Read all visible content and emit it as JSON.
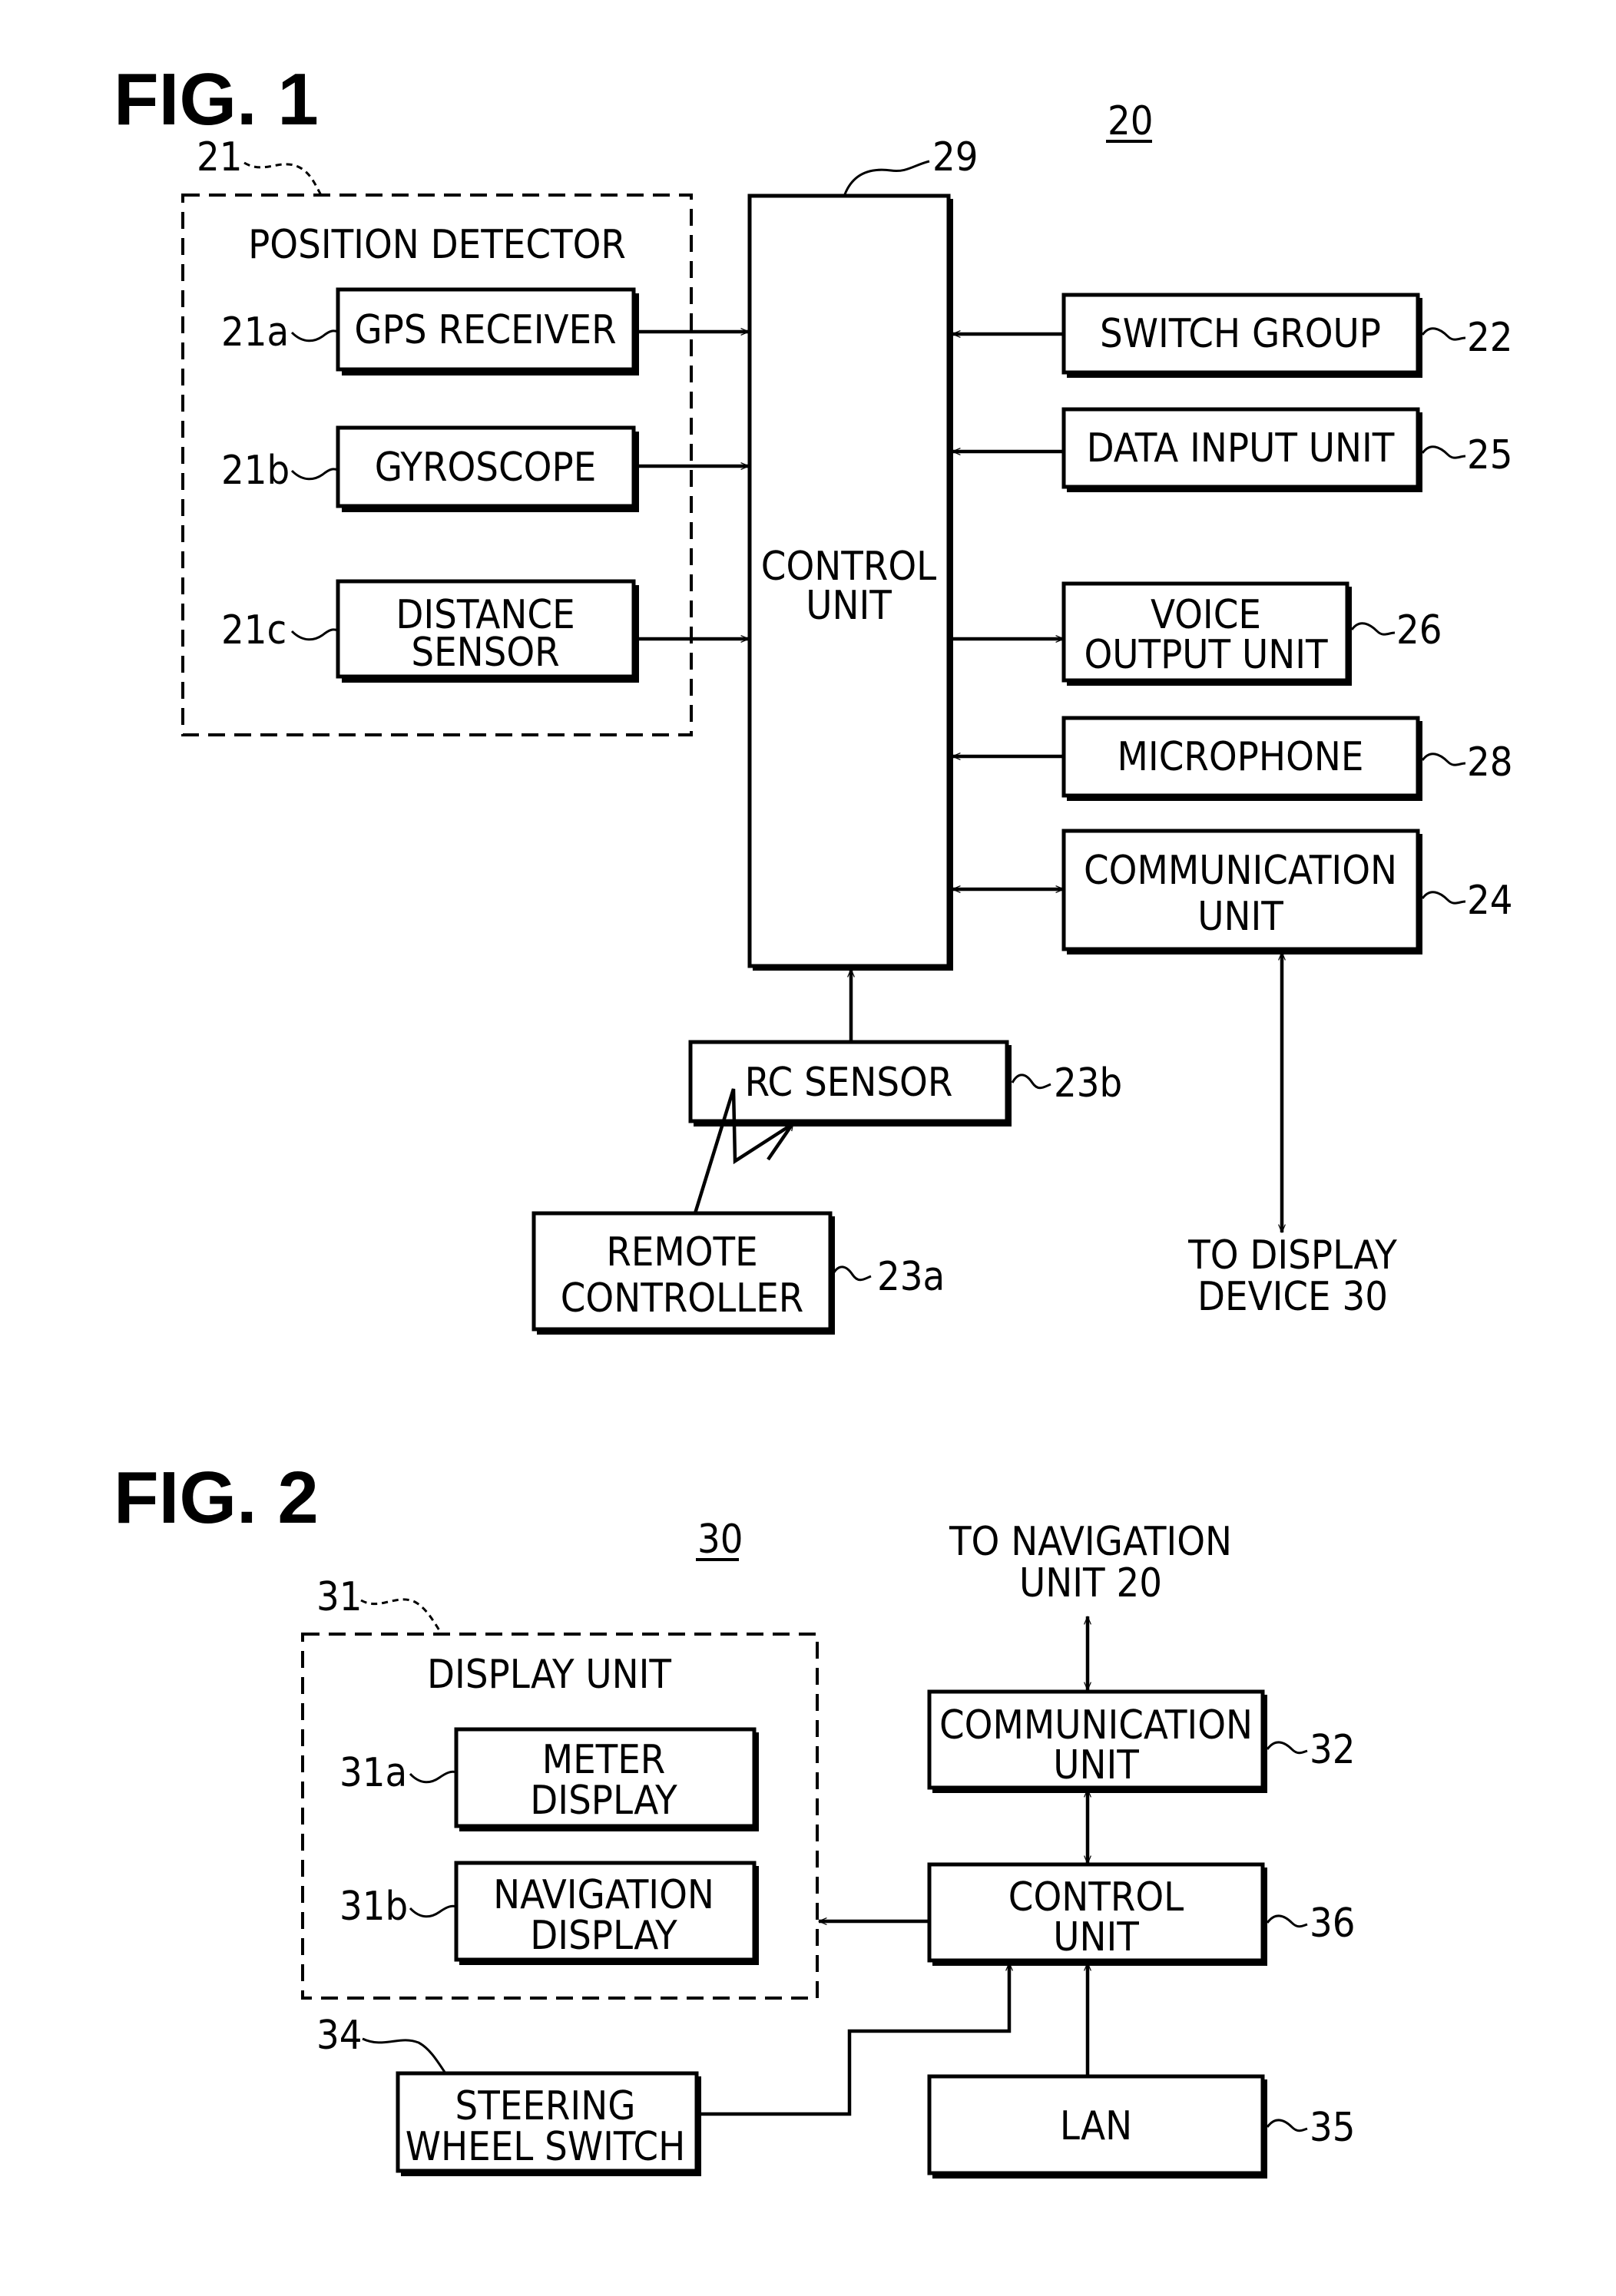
{
  "fig1": {
    "title": "FIG. 1",
    "device_ref": "20",
    "position_detector": {
      "ref": "21",
      "label": "POSITION DETECTOR"
    },
    "blocks": {
      "gps": {
        "ref": "21a",
        "lines": [
          "GPS RECEIVER"
        ]
      },
      "gyro": {
        "ref": "21b",
        "lines": [
          "GYROSCOPE"
        ]
      },
      "distance": {
        "ref": "21c",
        "lines": [
          "DISTANCE",
          "SENSOR"
        ]
      },
      "control": {
        "ref": "29",
        "lines": [
          "CONTROL",
          "UNIT"
        ]
      },
      "switch_group": {
        "ref": "22",
        "lines": [
          "SWITCH GROUP"
        ]
      },
      "data_input": {
        "ref": "25",
        "lines": [
          "DATA INPUT UNIT"
        ]
      },
      "voice_output": {
        "ref": "26",
        "lines": [
          "VOICE",
          "OUTPUT UNIT"
        ]
      },
      "microphone": {
        "ref": "28",
        "lines": [
          "MICROPHONE"
        ]
      },
      "communication": {
        "ref": "24",
        "lines": [
          "COMMUNICATION",
          "UNIT"
        ]
      },
      "rc_sensor": {
        "ref": "23b",
        "lines": [
          "RC SENSOR"
        ]
      },
      "remote": {
        "ref": "23a",
        "lines": [
          "REMOTE",
          "CONTROLLER"
        ]
      }
    },
    "to_display": [
      "TO DISPLAY",
      "DEVICE 30"
    ]
  },
  "fig2": {
    "title": "FIG. 2",
    "device_ref": "30",
    "display_unit": {
      "ref": "31",
      "label": "DISPLAY UNIT"
    },
    "blocks": {
      "meter": {
        "ref": "31a",
        "lines": [
          "METER",
          "DISPLAY"
        ]
      },
      "navigation": {
        "ref": "31b",
        "lines": [
          "NAVIGATION",
          "DISPLAY"
        ]
      },
      "communication": {
        "ref": "32",
        "lines": [
          "COMMUNICATION",
          "UNIT"
        ]
      },
      "control": {
        "ref": "36",
        "lines": [
          "CONTROL",
          "UNIT"
        ]
      },
      "lan": {
        "ref": "35",
        "lines": [
          "LAN"
        ]
      },
      "steering": {
        "ref": "34",
        "lines": [
          "STEERING",
          "WHEEL SWITCH"
        ]
      }
    },
    "to_navigation": [
      "TO NAVIGATION",
      "UNIT 20"
    ]
  }
}
